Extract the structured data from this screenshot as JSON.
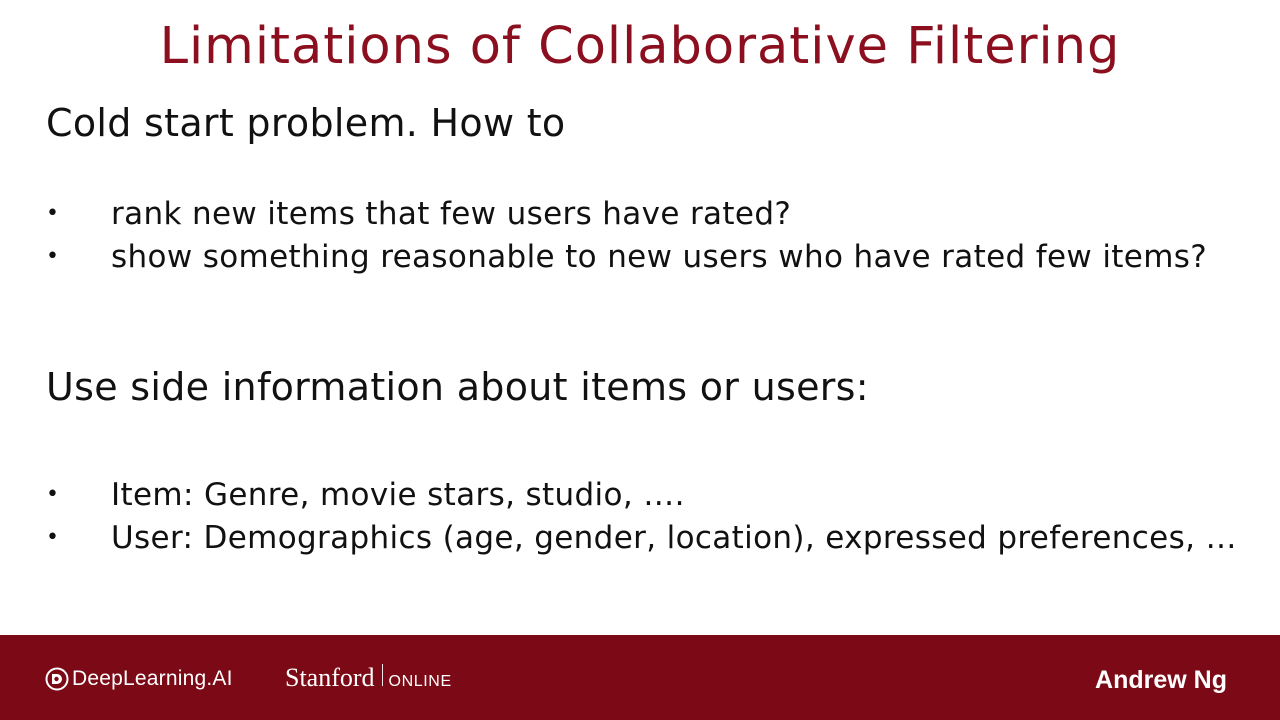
{
  "slide": {
    "title": "Limitations of Collaborative Filtering",
    "heading_1": "Cold start problem. How to",
    "bullets_1": [
      "rank new items that few users have rated?",
      "show something reasonable to new users who have rated few items?"
    ],
    "heading_2": "Use side information about items or users:",
    "bullets_2": [
      "Item: Genre, movie stars, studio, ….",
      "User: Demographics (age, gender, location), expressed preferences, …"
    ],
    "bullet_glyph": "•"
  },
  "footer": {
    "deeplearning_logo_text": "DeepLearning.AI",
    "stanford_word": "Stanford",
    "stanford_online": "ONLINE",
    "author": "Andrew Ng",
    "background_color": "#7b0a16"
  },
  "colors": {
    "title": "#8b0f1e",
    "text": "#111111"
  },
  "icons": {
    "deeplearning": "deeplearning-logo-icon"
  }
}
